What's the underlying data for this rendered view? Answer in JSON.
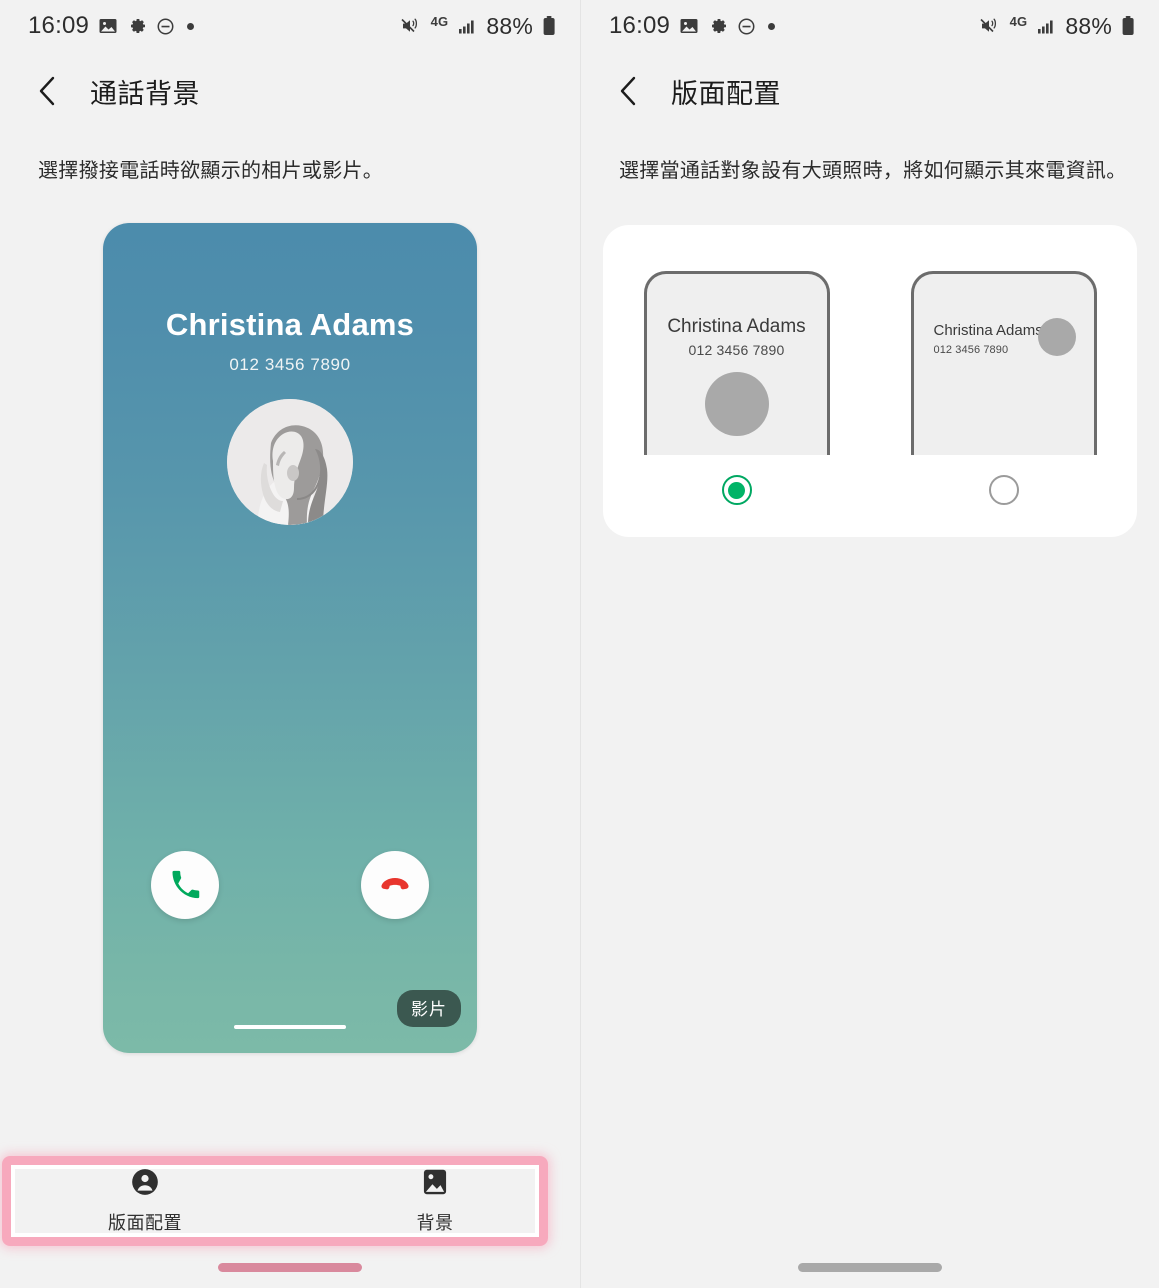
{
  "status_bar": {
    "time": "16:09",
    "left_icons": [
      "image-icon",
      "gear-icon",
      "do-not-disturb-icon",
      "dot-icon"
    ],
    "network_label": "4G",
    "battery_percent": "88%",
    "right_icons": [
      "mute-vibrate-icon",
      "signal-bars-icon",
      "battery-icon"
    ]
  },
  "left_panel": {
    "appbar": {
      "back_icon": "chevron-left-icon",
      "title": "通話背景"
    },
    "description": "選擇撥接電話時欲顯示的相片或影片。",
    "call_preview": {
      "contact_name": "Christina Adams",
      "phone_number": "012 3456 7890",
      "accept_icon": "phone-call-icon",
      "reject_icon": "phone-hangup-icon",
      "badge_label": "影片",
      "gradient_top": "#4c8cac",
      "gradient_bottom": "#7cbaa8",
      "accept_color": "#00a95c",
      "reject_color": "#e8352d"
    },
    "tabs": [
      {
        "icon": "person-icon",
        "label": "版面配置",
        "selected": true
      },
      {
        "icon": "image-icon",
        "label": "背景",
        "selected": false
      }
    ],
    "highlight_color": "#f7a9bd"
  },
  "right_panel": {
    "appbar": {
      "back_icon": "chevron-left-icon",
      "title": "版面配置"
    },
    "description": "選擇當通話對象設有大頭照時，將如何顯示其來電資訊。",
    "layout_options": [
      {
        "id": "centered",
        "contact_name": "Christina Adams",
        "phone_number": "012 3456 7890",
        "selected": true
      },
      {
        "id": "compact",
        "contact_name": "Christina Adams",
        "phone_number": "012 3456 7890",
        "selected": false
      }
    ],
    "accent_color": "#00b467"
  }
}
